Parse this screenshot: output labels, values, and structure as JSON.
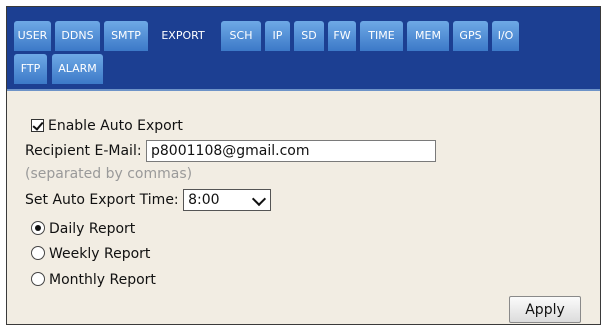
{
  "tabs": [
    {
      "label": "USER"
    },
    {
      "label": "DDNS"
    },
    {
      "label": "SMTP"
    },
    {
      "label": "EXPORT",
      "active": true
    },
    {
      "label": "SCH"
    },
    {
      "label": "IP"
    },
    {
      "label": "SD"
    },
    {
      "label": "FW"
    },
    {
      "label": "TIME"
    },
    {
      "label": "MEM"
    },
    {
      "label": "GPS"
    },
    {
      "label": "I/O"
    },
    {
      "label": "FTP"
    },
    {
      "label": "ALARM"
    }
  ],
  "export": {
    "enable_label": "Enable Auto Export",
    "enable_checked": true,
    "recipient_label": "Recipient E-Mail:",
    "recipient_value": "p8001108@gmail.com",
    "recipient_hint": "(separated by commas)",
    "time_label": "Set Auto Export Time:",
    "time_value": "8:00",
    "reports": [
      {
        "label": "Daily Report",
        "selected": true
      },
      {
        "label": "Weekly Report",
        "selected": false
      },
      {
        "label": "Monthly Report",
        "selected": false
      }
    ],
    "apply_label": "Apply"
  },
  "colors": {
    "tab_bar": "#1c3f92",
    "tab_bg": "#4f8ad6",
    "panel_bg": "#f2ede3"
  }
}
